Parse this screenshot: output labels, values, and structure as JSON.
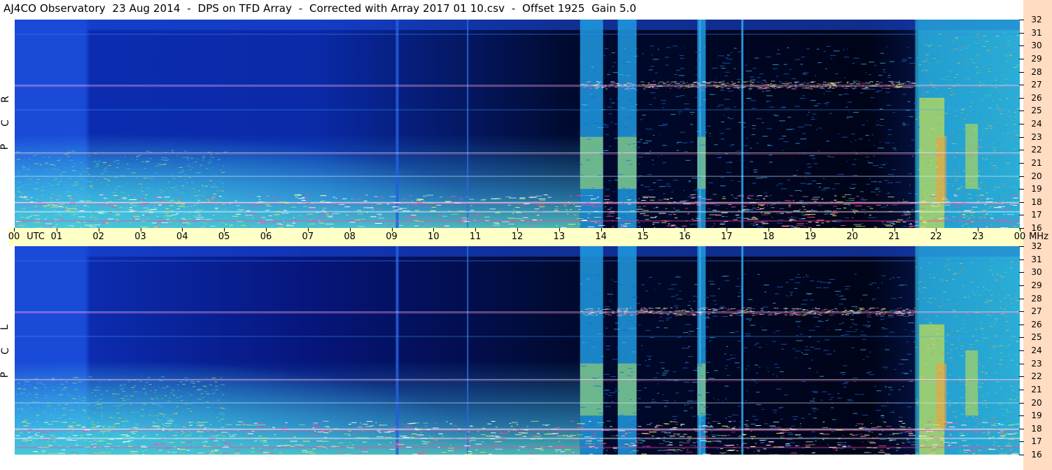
{
  "title": "AJ4CO Observatory  23 Aug 2014  -  DPS on TFD Array  -  Corrected with Array 2017 01 10.csv  -  Offset 1925  Gain 5.0",
  "time_axis": {
    "labels": [
      "00",
      "01",
      "02",
      "03",
      "04",
      "05",
      "06",
      "07",
      "08",
      "09",
      "10",
      "11",
      "12",
      "13",
      "14",
      "15",
      "16",
      "17",
      "18",
      "19",
      "20",
      "21",
      "22",
      "23",
      "00"
    ],
    "utc_label": "UTC",
    "mhz_label": "MHz"
  },
  "panels": [
    {
      "name": "RCP",
      "letters": [
        "R",
        "C",
        "P"
      ]
    },
    {
      "name": "LCP",
      "letters": [
        "L",
        "C",
        "P"
      ]
    }
  ],
  "colors": {
    "background_low": "#0a1a8c",
    "background_dark": "#000010",
    "mid_cyan": "#24c8e8",
    "hot_yellow": "#f0e040",
    "hot_orange": "#f0a040",
    "axis_band": "#ffffc8",
    "side_strip": "#ffdcc2"
  },
  "chart_data": {
    "type": "heatmap",
    "title": "AJ4CO Observatory  23 Aug 2014  -  DPS on TFD Array  -  Corrected with Array 2017 01 10.csv  -  Offset 1925  Gain 5.0",
    "x_axis": {
      "label": "UTC",
      "range": [
        0,
        24
      ],
      "ticks": [
        "00",
        "01",
        "02",
        "03",
        "04",
        "05",
        "06",
        "07",
        "08",
        "09",
        "10",
        "11",
        "12",
        "13",
        "14",
        "15",
        "16",
        "17",
        "18",
        "19",
        "20",
        "21",
        "22",
        "23",
        "00"
      ]
    },
    "y_axis": {
      "label": "MHz",
      "range": [
        16,
        32
      ],
      "ticks": [
        16,
        17,
        18,
        19,
        20,
        21,
        22,
        23,
        24,
        25,
        26,
        27,
        28,
        29,
        30,
        31,
        32
      ]
    },
    "series": [
      {
        "name": "RCP"
      },
      {
        "name": "LCP"
      }
    ],
    "description_bands": [
      {
        "from_utc": 0,
        "to_utc": 1.75,
        "level": "mid"
      },
      {
        "from_utc": 1.75,
        "to_utc": 4,
        "level": "low"
      },
      {
        "from_utc": 4,
        "to_utc": 13.5,
        "level": "very-low"
      },
      {
        "from_utc": 13.5,
        "to_utc": 14.05,
        "level": "high"
      },
      {
        "from_utc": 14.4,
        "to_utc": 14.85,
        "level": "high"
      },
      {
        "from_utc": 16.3,
        "to_utc": 16.5,
        "level": "high"
      },
      {
        "from_utc": 21.5,
        "to_utc": 24,
        "level": "very-high"
      }
    ]
  }
}
